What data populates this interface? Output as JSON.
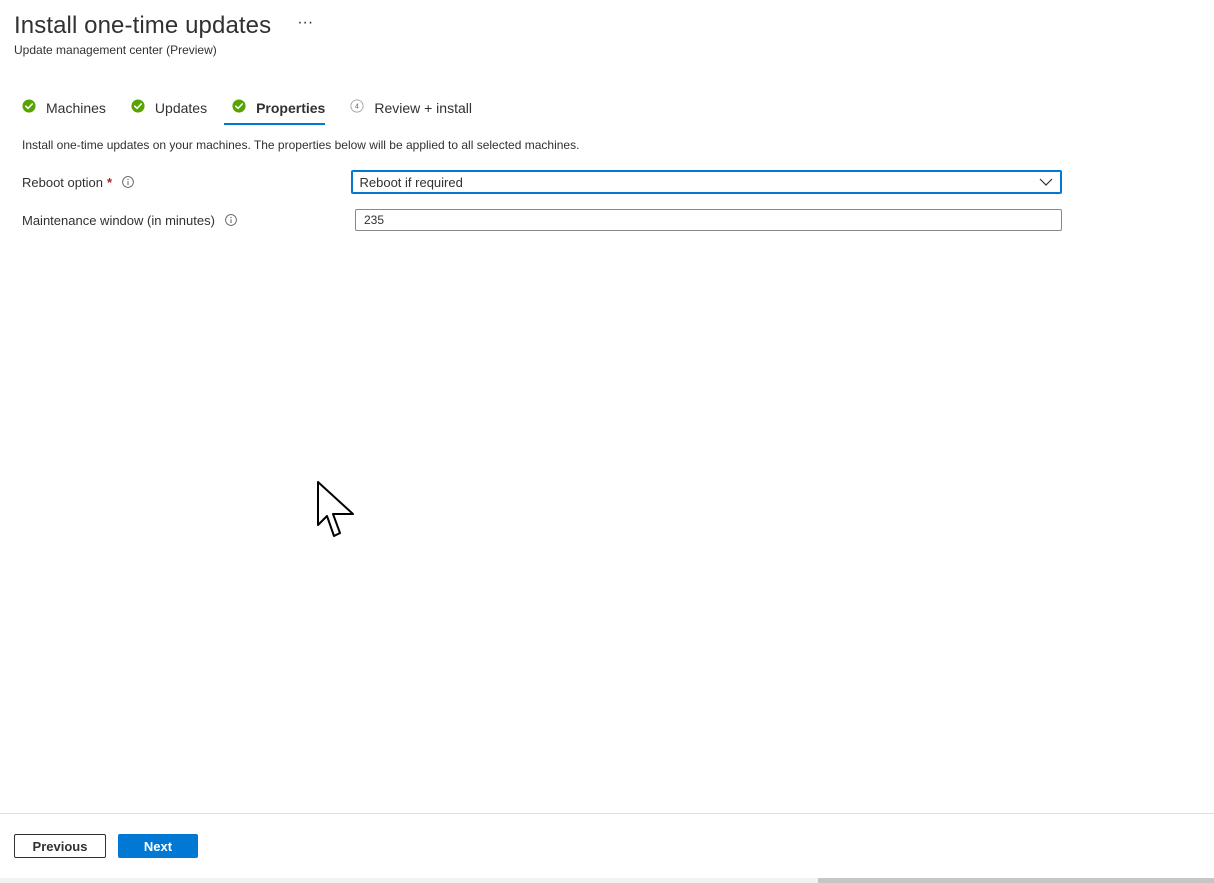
{
  "header": {
    "title": "Install one-time updates",
    "more_label": "···",
    "subtitle": "Update management center (Preview)"
  },
  "tabs": [
    {
      "label": "Machines",
      "status": "complete",
      "icon": "check-circle-icon"
    },
    {
      "label": "Updates",
      "status": "complete",
      "icon": "check-circle-icon"
    },
    {
      "label": "Properties",
      "status": "complete",
      "icon": "check-circle-icon",
      "active": true
    },
    {
      "label": "Review + install",
      "status": "pending",
      "step_number": "4",
      "icon": "step-number-icon"
    }
  ],
  "description": "Install one-time updates on your machines. The properties below will be applied to all selected machines.",
  "form": {
    "reboot": {
      "label": "Reboot option",
      "required_mark": "*",
      "value": "Reboot if required"
    },
    "maintenance": {
      "label": "Maintenance window (in minutes)",
      "value": "235"
    }
  },
  "footer": {
    "previous_label": "Previous",
    "next_label": "Next"
  },
  "colors": {
    "accent": "#0078d4",
    "success": "#57a300",
    "required": "#a4262c",
    "text": "#323130"
  }
}
